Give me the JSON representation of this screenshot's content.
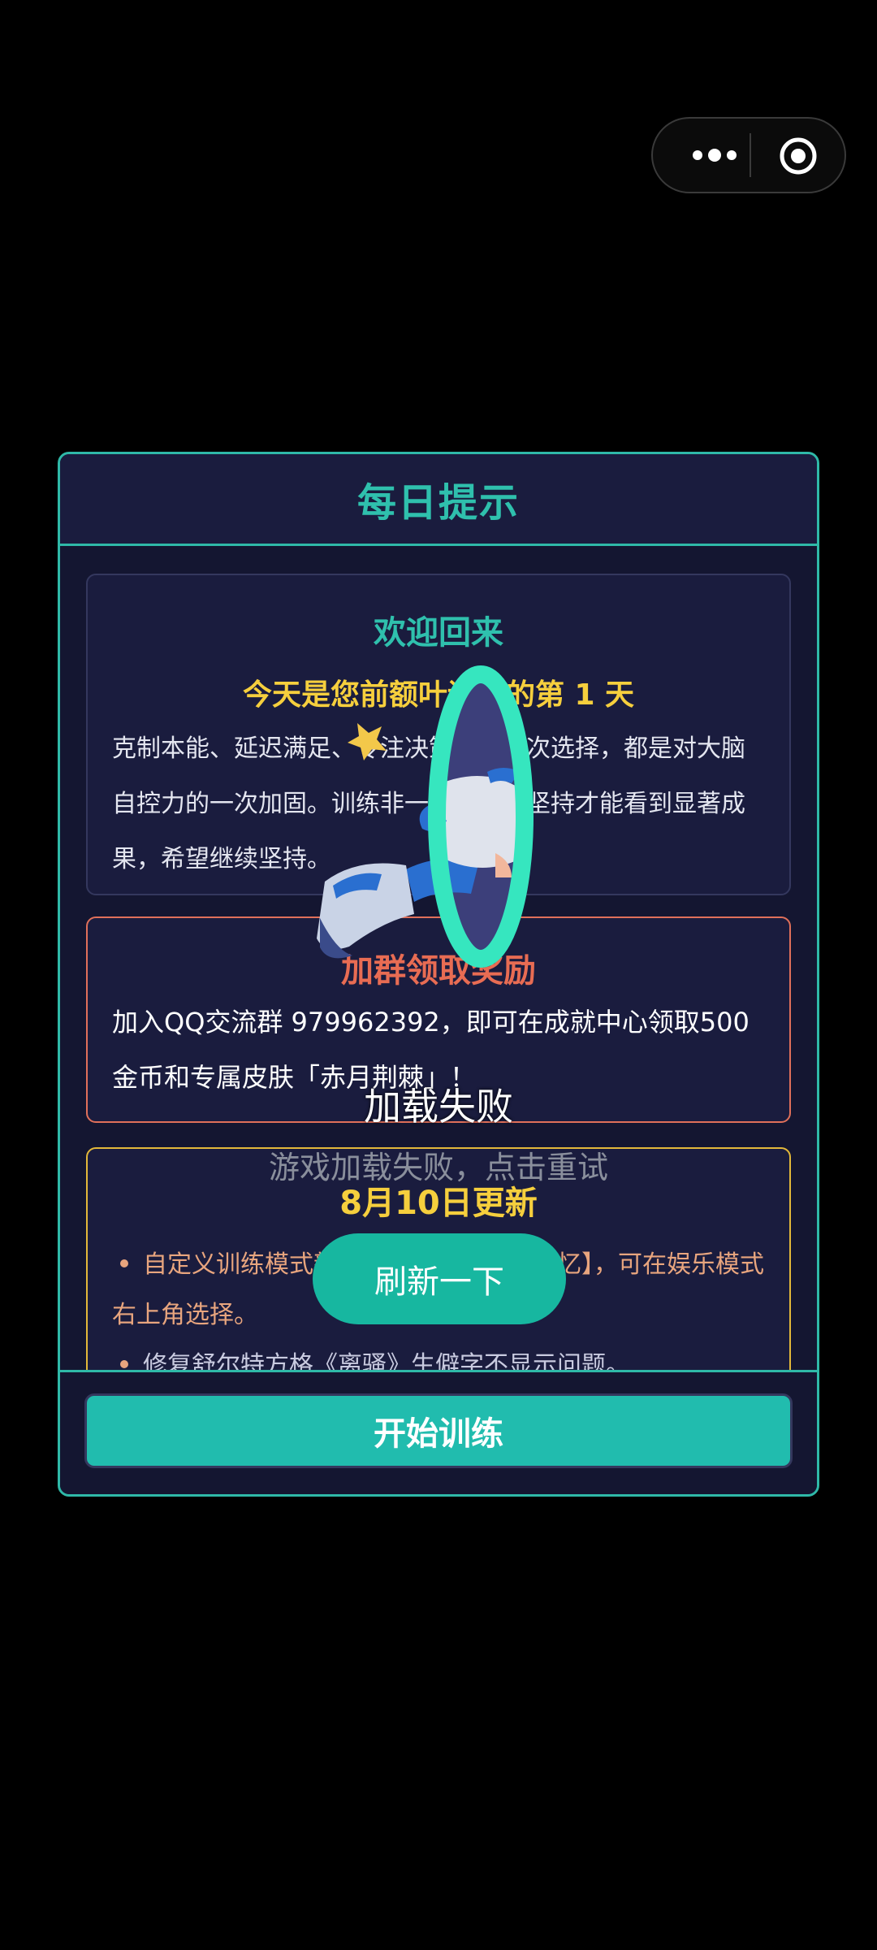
{
  "capsule": {
    "more_icon": "more-dots-icon",
    "close_icon": "target-icon"
  },
  "modal": {
    "title": "每日提示",
    "welcome": {
      "title": "欢迎回来",
      "days_text": "今天是您前额叶训练的第 1 天",
      "description": "克制本能、延迟满足、专注决策，每一次选择，都是对大脑自控力的一次加固。训练非一日之功，坚持才能看到显著成果，希望继续坚持。"
    },
    "reward": {
      "title": "加群领取奖励",
      "description": "加入QQ交流群 979962392，即可在成就中心领取500金币和专属皮肤「赤月荆棘」！"
    },
    "update": {
      "title": "8月10日更新",
      "items": [
        "自定义训练模式新增训练项目【序列记忆】，可在娱乐模式右上角选择。",
        "修复舒尔特方格《离骚》生僻字不显示问题。"
      ]
    },
    "start_label": "开始训练"
  },
  "overlay": {
    "title": "加载失败",
    "subtitle": "游戏加载失败，点击重试",
    "refresh_label": "刷新一下"
  },
  "colors": {
    "accent": "#2fb9a8",
    "gold": "#f6cf3d",
    "coral": "#e86c53",
    "panel": "#1a1c3e"
  }
}
